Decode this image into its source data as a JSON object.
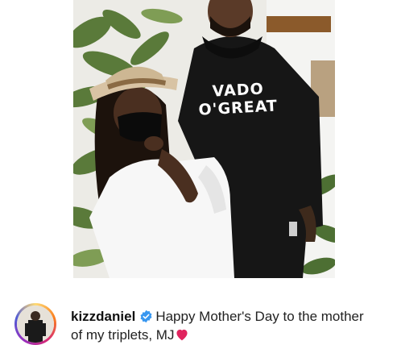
{
  "post": {
    "image_description_icon": "photo",
    "shirt_print": "VADO O'GREAT"
  },
  "caption": {
    "username": "kizzdaniel",
    "verified_icon": "verified-badge-icon",
    "text_line1": "Happy Mother's Day to the mother",
    "text_line2": "of my triplets, MJ",
    "emoji_icon": "red-heart-icon"
  },
  "colors": {
    "verified_blue": "#3897f0",
    "heart_red": "#e0245e"
  }
}
